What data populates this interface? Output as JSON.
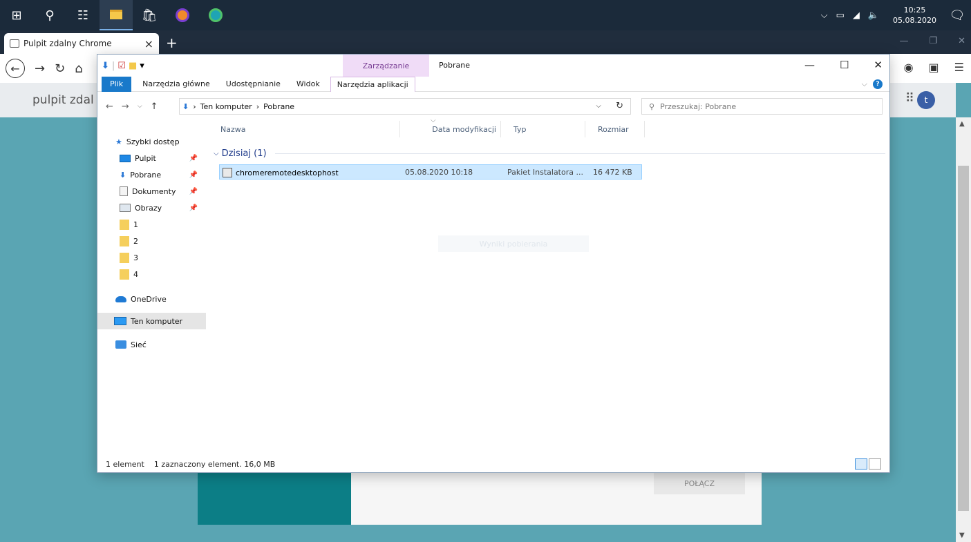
{
  "taskbar": {
    "icons": [
      "windows-start-icon",
      "search-icon",
      "task-view-icon",
      "file-explorer-icon",
      "store-icon",
      "firefox-icon",
      "edge-icon"
    ],
    "time": "10:25",
    "date": "05.08.2020"
  },
  "browser": {
    "tab_title": "Pulpit zdalny Chrome",
    "new_tab": "+",
    "page_title": "pulpit zdal",
    "account_initial": "t",
    "connect_label": "POŁĄCZ"
  },
  "explorer": {
    "context_tab_header": "Zarządzanie",
    "window_title": "Pobrane",
    "ribbon_tabs": {
      "file": "Plik",
      "home": "Narzędzia główne",
      "share": "Udostępnianie",
      "view": "Widok",
      "app_tools": "Narzędzia aplikacji"
    },
    "address": {
      "crumb1": "Ten komputer",
      "sep": "›",
      "crumb2": "Pobrane"
    },
    "search_placeholder": "Przeszukaj: Pobrane",
    "nav": {
      "quick_access": "Szybki dostęp",
      "desktop": "Pulpit",
      "downloads": "Pobrane",
      "documents": "Dokumenty",
      "pictures": "Obrazy",
      "f1": "1",
      "f2": "2",
      "f3": "3",
      "f4": "4",
      "onedrive": "OneDrive",
      "this_pc": "Ten komputer",
      "network": "Sieć"
    },
    "columns": {
      "name": "Nazwa",
      "date": "Data modyfikacji",
      "type": "Typ",
      "size": "Rozmiar"
    },
    "group": "Dzisiaj (1)",
    "file": {
      "name": "chromeremotedesktophost",
      "date": "05.08.2020 10:18",
      "type": "Pakiet Instalatora ...",
      "size": "16 472 KB"
    },
    "ghost_text": "Wyniki pobierania",
    "status": {
      "count": "1 element",
      "selected": "1 zaznaczony element. 16,0 MB"
    }
  }
}
